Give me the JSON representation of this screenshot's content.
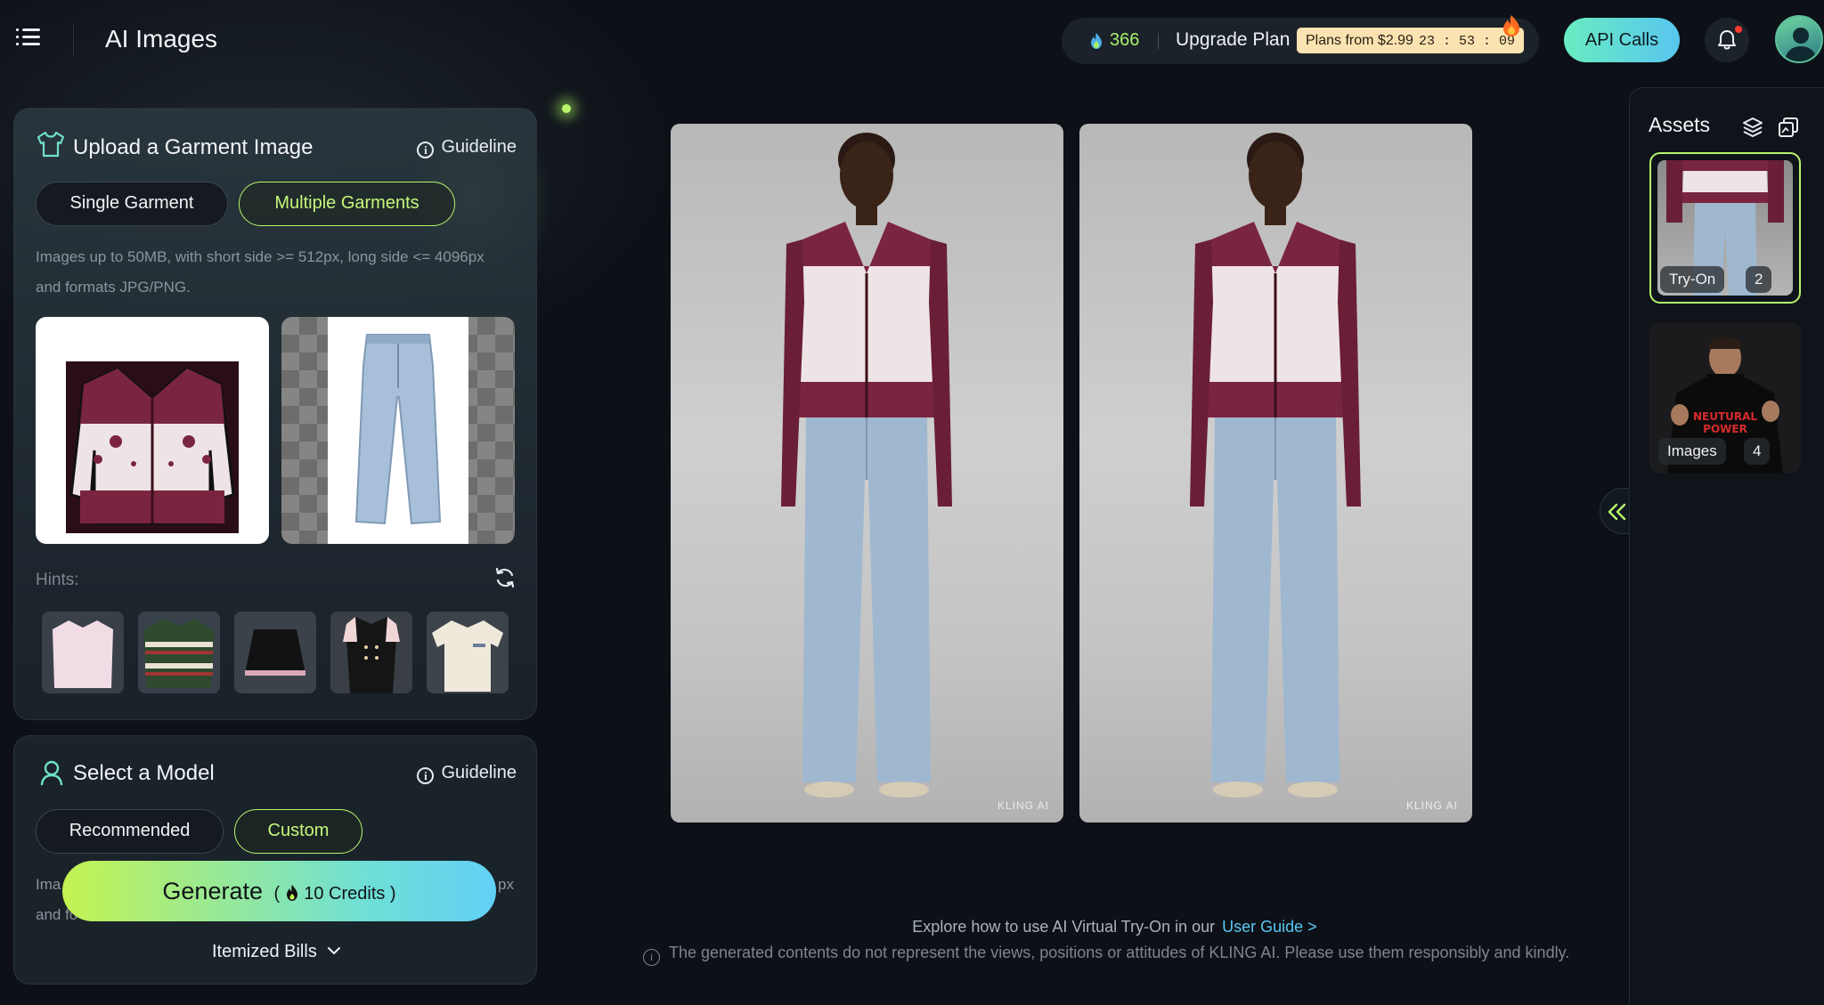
{
  "header": {
    "title": "AI Images",
    "credits": "366",
    "upgrade_label": "Upgrade Plan",
    "promo_text": "Plans from $2.99",
    "promo_timer": "23 : 53 : 09",
    "api_label": "API Calls"
  },
  "garment_panel": {
    "title": "Upload a Garment Image",
    "guideline": "Guideline",
    "tabs": [
      "Single Garment",
      "Multiple Garments"
    ],
    "active_tab": "Multiple Garments",
    "requirements": [
      "Images up to 50MB, with short side >= 512px, long side <= 4096px",
      "and formats JPG/PNG."
    ],
    "hints_label": "Hints:"
  },
  "model_panel": {
    "title": "Select a Model",
    "guideline": "Guideline",
    "tabs": [
      "Recommended",
      "Custom"
    ],
    "active_tab": "Custom",
    "partial_text": [
      "Ima",
      "px",
      "and fo"
    ]
  },
  "generate": {
    "label": "Generate",
    "credits_text": "10 Credits",
    "itemized": "Itemized Bills"
  },
  "results": {
    "watermark": "KLING AI"
  },
  "footer": {
    "explore_text": "Explore how to use AI Virtual Try-On in our",
    "user_guide": "User Guide >",
    "disclaimer": "The generated contents do not represent the views, positions or attitudes of KLING AI. Please use them responsibly and kindly."
  },
  "assets": {
    "title": "Assets",
    "cards": [
      {
        "label": "Try-On",
        "count": "2"
      },
      {
        "label": "Images",
        "count": "4"
      }
    ],
    "poster_text": "NEUTURAL POWER"
  },
  "colors": {
    "accent": "#b8f56d",
    "link": "#5ac8f5",
    "background": "#0d1117"
  }
}
